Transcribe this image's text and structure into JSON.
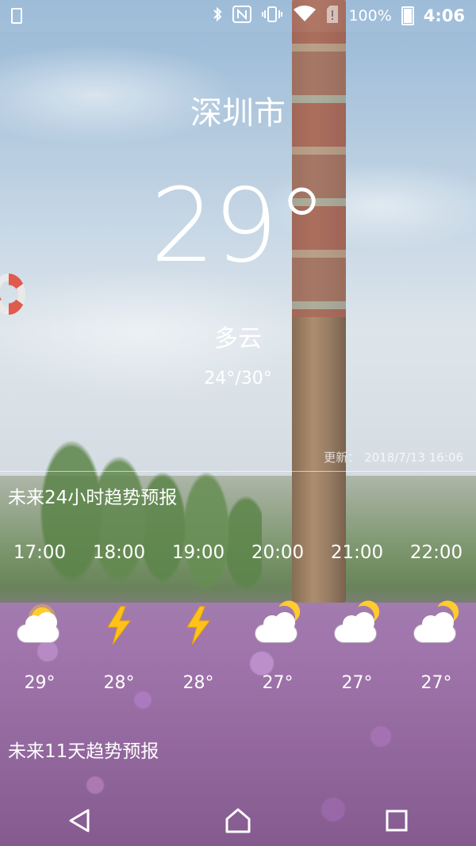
{
  "status_bar": {
    "battery_pct": "100%",
    "time": "4:06",
    "icons": [
      "image-notification-icon",
      "bluetooth-icon",
      "nfc-icon",
      "vibrate-icon",
      "wifi-icon",
      "sim-alert-icon",
      "battery-icon"
    ]
  },
  "weather": {
    "city": "深圳市",
    "temp": "29°",
    "condition": "多云",
    "range": "24°/30°",
    "updated_label": "更新：",
    "updated_time": "2018/7/13  16:06"
  },
  "sections": {
    "hourly_title": "未来24小时趋势预报",
    "daily_title": "未来11天趋势预报"
  },
  "hourly": [
    {
      "time": "17:00",
      "icon": "cloud-sun-icon",
      "temp": "29°"
    },
    {
      "time": "18:00",
      "icon": "lightning-icon",
      "temp": "28°"
    },
    {
      "time": "19:00",
      "icon": "lightning-icon",
      "temp": "28°"
    },
    {
      "time": "20:00",
      "icon": "cloud-moon-icon",
      "temp": "27°"
    },
    {
      "time": "21:00",
      "icon": "cloud-moon-icon",
      "temp": "27°"
    },
    {
      "time": "22:00",
      "icon": "cloud-moon-icon",
      "temp": "27°"
    }
  ],
  "colors": {
    "text": "#ffffff",
    "sun": "#ffcb2f",
    "bolt": "#ffc21a",
    "lifebuoy_red": "#e05a4d"
  },
  "navigation": [
    "back-icon",
    "home-icon",
    "recents-icon"
  ]
}
